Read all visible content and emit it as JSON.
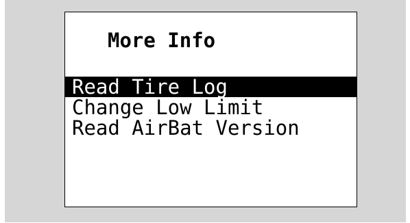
{
  "screen": {
    "title": "More Info"
  },
  "menu": {
    "items": [
      {
        "label": "Read Tire Log",
        "selected": true
      },
      {
        "label": "Change Low Limit",
        "selected": false
      },
      {
        "label": "Read AirBat Version",
        "selected": false
      }
    ]
  },
  "colors": {
    "frame_background": "#d6d6d6",
    "screen_background": "#ffffff",
    "text": "#000000",
    "selection_background": "#000000",
    "selection_text": "#ffffff"
  }
}
